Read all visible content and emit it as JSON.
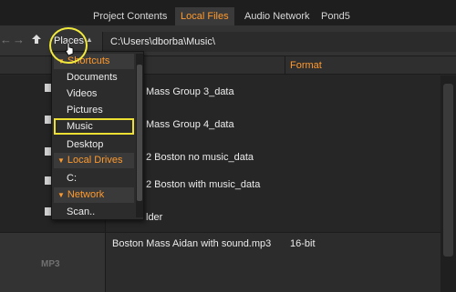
{
  "tabs": [
    {
      "label": "Project Contents"
    },
    {
      "label": "Local Files"
    },
    {
      "label": "Audio Network"
    },
    {
      "label": "Pond5"
    }
  ],
  "toolbar": {
    "places_label": "Places",
    "path": "C:\\Users\\dborba\\Music\\"
  },
  "columns": {
    "format": "Format"
  },
  "places_menu": {
    "shortcuts_header": "Shortcuts",
    "shortcuts": [
      "Documents",
      "Videos",
      "Pictures",
      "Music",
      "Desktop"
    ],
    "drives_header": "Local Drives",
    "drives": [
      "C:"
    ],
    "network_header": "Network",
    "network": [
      "Scan.."
    ]
  },
  "files": [
    {
      "name": "Mass Group 3_data"
    },
    {
      "name": "Mass Group 4_data"
    },
    {
      "name": "2 Boston no music_data"
    },
    {
      "name": "2 Boston with music_data"
    },
    {
      "name": "lder"
    }
  ],
  "mp3_row": {
    "thumb_label": "MP3",
    "name": "Boston Mass Aidan with sound.mp3",
    "format": "16-bit"
  },
  "colors": {
    "accent": "#ff9a2e",
    "highlight": "#f1ea3c"
  }
}
